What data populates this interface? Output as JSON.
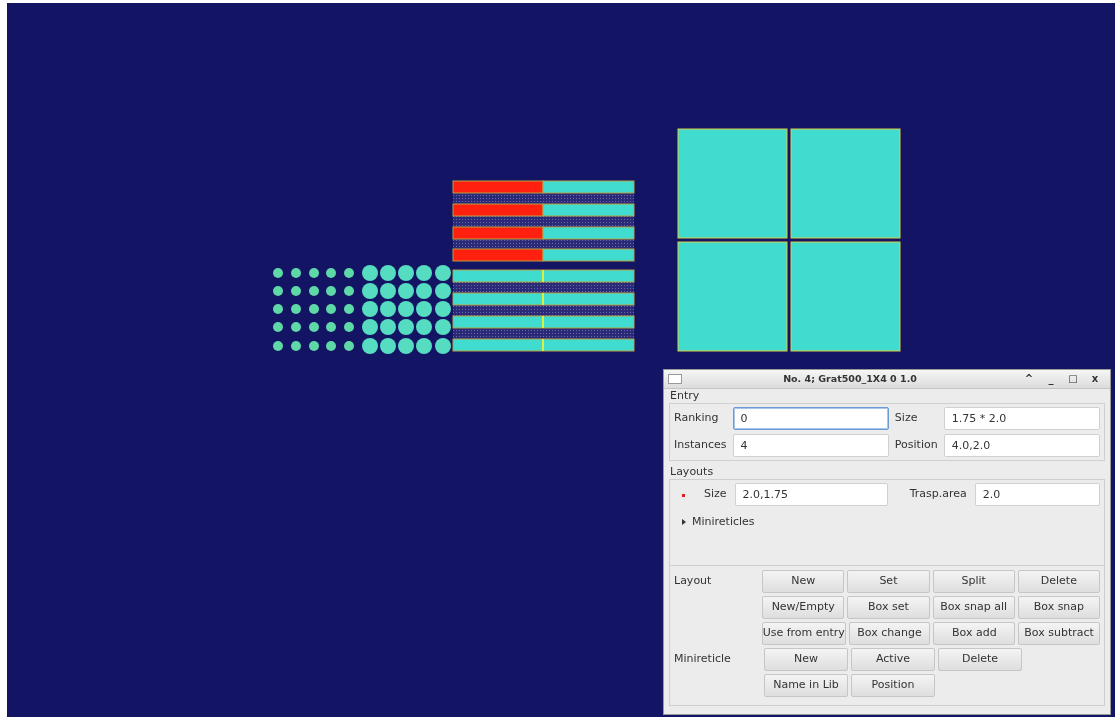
{
  "window": {
    "title": "No. 4; Grat500_1X4 0 1.0",
    "controls": [
      "^",
      "_",
      "□",
      "x"
    ]
  },
  "entry": {
    "title": "Entry",
    "fields": [
      {
        "label": "Ranking",
        "value": "0",
        "focused": true
      },
      {
        "label": "Size",
        "value": "1.75 * 2.0",
        "focused": false
      },
      {
        "label": "Instances",
        "value": "4",
        "focused": false
      },
      {
        "label": "Position",
        "value": "4.0,2.0",
        "focused": false
      }
    ]
  },
  "layouts": {
    "title": "Layouts",
    "fields": [
      {
        "label": "Size",
        "value": "2.0,1.75",
        "marker": true
      },
      {
        "label": "Trasp.area",
        "value": "2.0",
        "marker": false
      }
    ],
    "expander": {
      "label": "Minireticles",
      "expanded": false
    }
  },
  "button_rows": [
    {
      "label": "Layout",
      "buttons": [
        "New",
        "Set",
        "Split",
        "Delete"
      ]
    },
    {
      "label": "",
      "buttons": [
        "New/Empty",
        "Box set",
        "Box snap all",
        "Box snap"
      ]
    },
    {
      "label": "",
      "buttons": [
        "Use from entry",
        "Box change",
        "Box add",
        "Box subtract"
      ]
    },
    {
      "label": "Minireticle",
      "buttons": [
        "New",
        "Active",
        "Delete"
      ]
    },
    {
      "label": "",
      "buttons": [
        "Name in Lib",
        "Position"
      ]
    }
  ]
}
